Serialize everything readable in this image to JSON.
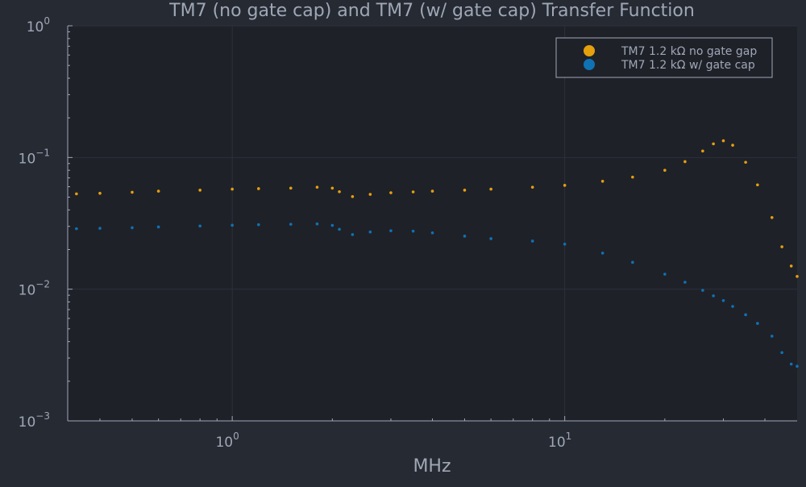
{
  "chart_data": {
    "type": "scatter",
    "title": "TM7 (no gate cap) and TM7 (w/ gate cap) Transfer Function",
    "xlabel": "MHz",
    "ylabel": "",
    "xscale": "log",
    "yscale": "log",
    "xlim": [
      0.32,
      50
    ],
    "ylim": [
      0.001,
      1
    ],
    "x_ticks": [
      {
        "value": 1,
        "base": "10",
        "exp": "0"
      },
      {
        "value": 10,
        "base": "10",
        "exp": "1"
      }
    ],
    "y_ticks": [
      {
        "value": 1,
        "base": "10",
        "exp": "0"
      },
      {
        "value": 0.1,
        "base": "10",
        "exp": "−1"
      },
      {
        "value": 0.01,
        "base": "10",
        "exp": "−2"
      },
      {
        "value": 0.001,
        "base": "10",
        "exp": "−3"
      }
    ],
    "grid": true,
    "legend_position": "top-right",
    "background": "#262a33",
    "plot_background": "#1f2129",
    "text_color": "#9fa7b5",
    "x": [
      0.34,
      0.4,
      0.5,
      0.6,
      0.8,
      1.0,
      1.2,
      1.5,
      1.8,
      2.0,
      2.1,
      2.3,
      2.6,
      3.0,
      3.5,
      4,
      5,
      6,
      8,
      10,
      13,
      16,
      20,
      23,
      26,
      28,
      30,
      32,
      35,
      38,
      42,
      45,
      48,
      50
    ],
    "series": [
      {
        "name": "TM7 1.2 kΩ no gate gap",
        "color": "#e5a00d",
        "values": [
          0.053,
          0.0535,
          0.0545,
          0.0555,
          0.0565,
          0.0575,
          0.058,
          0.0585,
          0.0595,
          0.0585,
          0.055,
          0.0505,
          0.0525,
          0.054,
          0.0548,
          0.0555,
          0.0565,
          0.0575,
          0.0595,
          0.0615,
          0.066,
          0.071,
          0.08,
          0.093,
          0.112,
          0.127,
          0.134,
          0.124,
          0.092,
          0.062,
          0.035,
          0.021,
          0.015,
          0.0125
        ]
      },
      {
        "name": "TM7 1.2 kΩ w/ gate cap",
        "color": "#0f72b3",
        "values": [
          0.0288,
          0.029,
          0.0293,
          0.0297,
          0.0302,
          0.0306,
          0.0309,
          0.0311,
          0.0313,
          0.0305,
          0.0285,
          0.026,
          0.0272,
          0.0278,
          0.0276,
          0.0268,
          0.0253,
          0.0242,
          0.0232,
          0.022,
          0.0188,
          0.016,
          0.013,
          0.0113,
          0.0098,
          0.0089,
          0.0082,
          0.0074,
          0.0064,
          0.0055,
          0.0044,
          0.0033,
          0.0027,
          0.0026
        ]
      }
    ]
  }
}
